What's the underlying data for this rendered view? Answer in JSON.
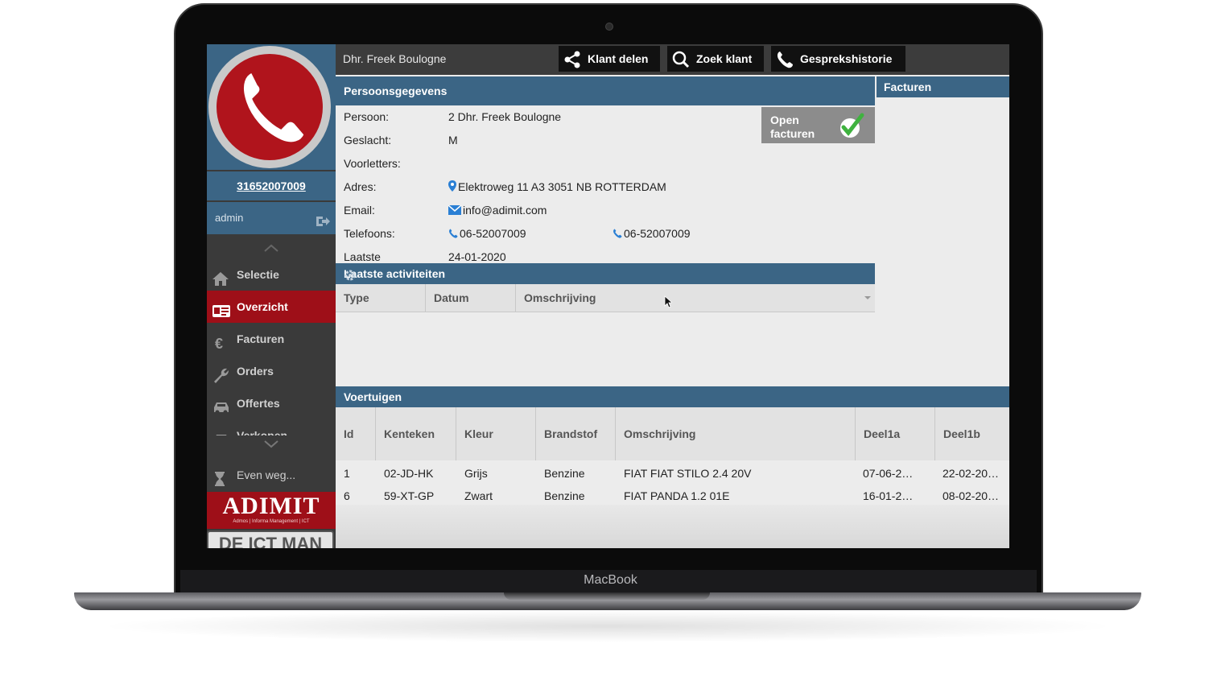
{
  "device": {
    "brand": "MacBook"
  },
  "sidebar": {
    "phone_number": "31652007009",
    "user": "admin",
    "nav": [
      {
        "label": "Selectie",
        "icon": "home-icon",
        "active": false
      },
      {
        "label": "Overzicht",
        "icon": "id-card-icon",
        "active": true
      },
      {
        "label": "Facturen",
        "icon": "euro-icon",
        "active": false
      },
      {
        "label": "Orders",
        "icon": "wrench-icon",
        "active": false
      },
      {
        "label": "Offertes",
        "icon": "car-icon",
        "active": false
      },
      {
        "label": "Verkopen",
        "icon": "car-icon",
        "active": false
      }
    ],
    "away_label": "Even weg...",
    "logo": {
      "title": "ADIMIT",
      "subtitle": "Admos | Informa Management | ICT"
    },
    "banner": "DE ICT MAN"
  },
  "topbar": {
    "customer": "Dhr. Freek Boulogne",
    "buttons": [
      {
        "label": "Klant delen",
        "icon": "share-icon"
      },
      {
        "label": "Zoek klant",
        "icon": "search-icon"
      },
      {
        "label": "Gesprekshistorie",
        "icon": "phone-icon"
      }
    ]
  },
  "person": {
    "title": "Persoonsgegevens",
    "fields": [
      {
        "label": "Persoon:",
        "value": "2 Dhr. Freek Boulogne"
      },
      {
        "label": "Geslacht:",
        "value": "M"
      },
      {
        "label": "Voorletters:",
        "value": ""
      },
      {
        "label": "Adres:",
        "value": "Elektroweg 11 A3 3051 NB ROTTERDAM",
        "icon": "map-pin-icon"
      },
      {
        "label": "Email:",
        "value": "info@adimit.com",
        "icon": "envelope-icon"
      },
      {
        "label": "Telefoons:",
        "value": "06-52007009",
        "value2": "06-52007009",
        "icon": "phone-icon"
      },
      {
        "label": "Laatste bezoek:",
        "value": "24-01-2020"
      }
    ],
    "open_invoices": "Open facturen"
  },
  "invoices_panel": {
    "title": "Facturen"
  },
  "activities": {
    "title": "Laatste activiteiten",
    "columns": [
      "Type",
      "Datum",
      "Omschrijving"
    ],
    "rows": []
  },
  "vehicles": {
    "title": "Voertuigen",
    "columns": [
      "Id",
      "Kenteken",
      "Kleur",
      "Brandstof",
      "Omschrijving",
      "Deel1a",
      "Deel1b"
    ],
    "rows": [
      [
        "1",
        "02-JD-HK",
        "Grijs",
        "Benzine",
        "FIAT FIAT STILO 2.4 20V",
        "07-06-2…",
        "22-02-20…"
      ],
      [
        "6",
        "59-XT-GP",
        "Zwart",
        "Benzine",
        "FIAT PANDA 1.2 01E",
        "16-01-2…",
        "08-02-20…"
      ]
    ]
  },
  "colors": {
    "header_blue": "#3b6585",
    "accent_red": "#9e0f18",
    "dark": "#3a3a3a"
  }
}
